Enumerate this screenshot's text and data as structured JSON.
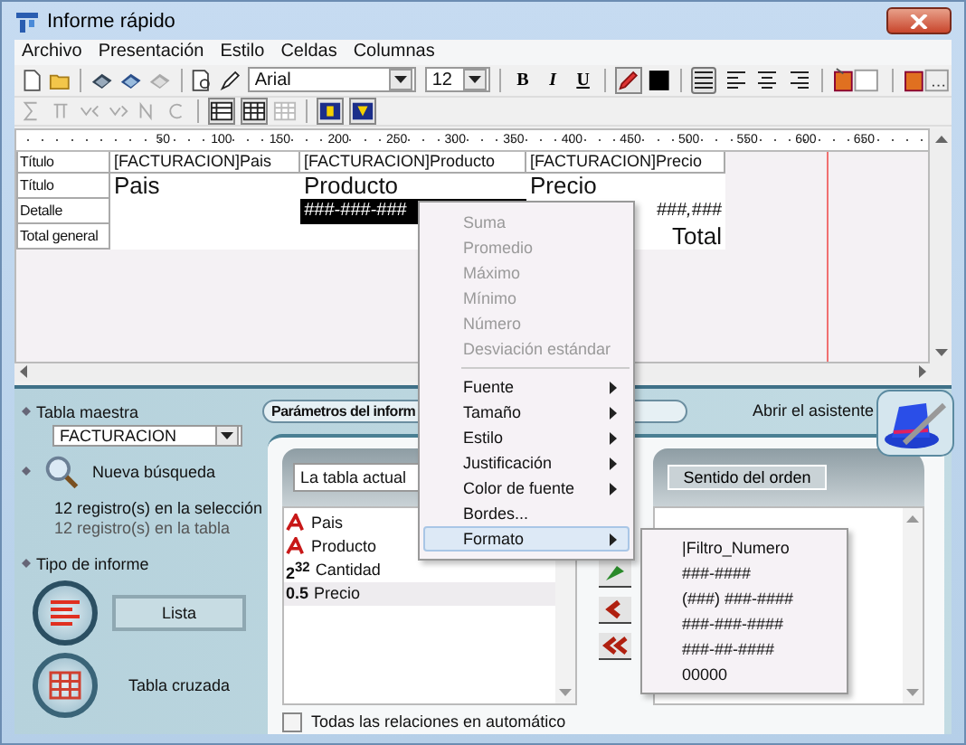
{
  "window": {
    "title": "Informe rápido"
  },
  "menu": [
    "Archivo",
    "Presentación",
    "Estilo",
    "Celdas",
    "Columnas"
  ],
  "toolbar": {
    "font": "Arial",
    "size": "12",
    "format_buttons": [
      "B",
      "I",
      "U"
    ],
    "align_buttons": [
      {
        "selected": true
      },
      {
        "selected": false
      },
      {
        "selected": false
      },
      {
        "selected": false
      }
    ]
  },
  "ruler": [
    "50",
    "100",
    "150",
    "200",
    "250",
    "300",
    "350",
    "400",
    "450",
    "500",
    "550",
    "600",
    "650"
  ],
  "grid": {
    "rows": [
      {
        "label": "Título",
        "kind": "header",
        "cells": [
          {
            "text": "[FACTURACION]Pais",
            "selected": false
          },
          {
            "text": "[FACTURACION]Producto",
            "selected": false
          },
          {
            "text": "[FACTURACION]Precio",
            "selected": false
          }
        ]
      },
      {
        "label": "Título",
        "kind": "title",
        "cells": [
          {
            "text": "Pais",
            "selected": false
          },
          {
            "text": "Producto",
            "selected": false
          },
          {
            "text": "Precio",
            "selected": false
          }
        ]
      },
      {
        "label": "Detalle",
        "kind": "detail",
        "cells": [
          {
            "selected": false
          },
          {
            "text": "###-###-###",
            "selected": true
          },
          {
            "text": "###,###",
            "selected": false
          }
        ]
      },
      {
        "label": "Total general",
        "kind": "total",
        "cells": [
          {
            "selected": false
          },
          {
            "selected": false
          },
          {
            "text": "Total",
            "selected": false
          }
        ]
      }
    ]
  },
  "master_table": {
    "label": "Tabla maestra",
    "value": "FACTURACION"
  },
  "new_search": "Nueva búsqueda",
  "records": [
    "12 registro(s) en la selección",
    "12 registro(s) en la tabla"
  ],
  "report_type": {
    "label": "Tipo de informe",
    "options": [
      {
        "label": "Lista",
        "kind": "list",
        "selected": true
      },
      {
        "label": "Tabla cruzada",
        "kind": "grid",
        "selected": false
      }
    ]
  },
  "params_tab": "Parámetros del inform",
  "wizard": "Abrir el asistente",
  "table_select": "La tabla actual",
  "fields": [
    {
      "kind": "text",
      "label": "Pais",
      "selected": false
    },
    {
      "kind": "text",
      "label": "Producto",
      "selected": false
    },
    {
      "kind": "number",
      "badge": "2$^{32}$",
      "label": "Cantidad",
      "selected": false
    },
    {
      "kind": "number",
      "badge": "0.5",
      "label": "Precio",
      "selected": true
    }
  ],
  "sort_header": "Sentido del orden",
  "auto_relations": {
    "label": "Todas las relaciones en automático",
    "checked": false
  },
  "context_menu": [
    {
      "kind": "item",
      "label": "Suma",
      "disabled": true,
      "submenu": false,
      "selected": false
    },
    {
      "kind": "item",
      "label": "Promedio",
      "disabled": true,
      "submenu": false,
      "selected": false
    },
    {
      "kind": "item",
      "label": "Máximo",
      "disabled": true,
      "submenu": false,
      "selected": false
    },
    {
      "kind": "item",
      "label": "Mínimo",
      "disabled": true,
      "submenu": false,
      "selected": false
    },
    {
      "kind": "item",
      "label": "Número",
      "disabled": true,
      "submenu": false,
      "selected": false
    },
    {
      "kind": "item",
      "label": "Desviación estándar",
      "disabled": true,
      "submenu": false,
      "selected": false
    },
    {
      "kind": "separator"
    },
    {
      "kind": "item",
      "label": "Fuente",
      "disabled": false,
      "submenu": true,
      "selected": false
    },
    {
      "kind": "item",
      "label": "Tamaño",
      "disabled": false,
      "submenu": true,
      "selected": false
    },
    {
      "kind": "item",
      "label": "Estilo",
      "disabled": false,
      "submenu": true,
      "selected": false
    },
    {
      "kind": "item",
      "label": "Justificación",
      "disabled": false,
      "submenu": true,
      "selected": false
    },
    {
      "kind": "item",
      "label": "Color de fuente",
      "disabled": false,
      "submenu": true,
      "selected": false
    },
    {
      "kind": "item",
      "label": "Bordes...",
      "disabled": false,
      "submenu": false,
      "selected": false
    },
    {
      "kind": "item",
      "label": "Formato",
      "disabled": false,
      "submenu": true,
      "selected": true
    }
  ],
  "submenu": [
    "|Filtro_Numero",
    "###-####",
    "(###) ###-####",
    "###-###-####",
    "###-##-####",
    "00000"
  ]
}
